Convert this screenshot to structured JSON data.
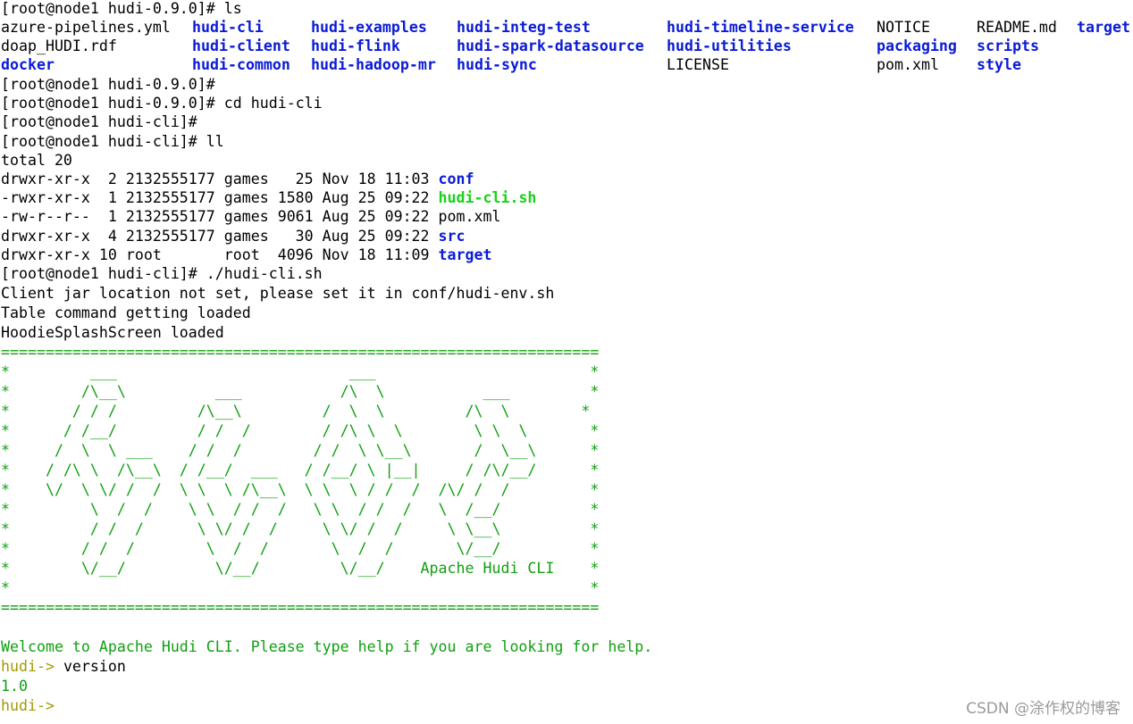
{
  "terminal": {
    "prompt_node": "[root@node1 hudi-0.9.0]#",
    "prompt_cli_dir": "[root@node1 hudi-cli]#",
    "cmd_ls": " ls",
    "cmd_cd": " cd hudi-cli",
    "cmd_ll": " ll",
    "cmd_run": " ./hudi-cli.sh",
    "ls_output": [
      [
        {
          "text": "azure-pipelines.yml",
          "kind": "file"
        },
        {
          "text": "hudi-cli",
          "kind": "dir"
        },
        {
          "text": "hudi-examples",
          "kind": "dir"
        },
        {
          "text": "hudi-integ-test",
          "kind": "dir"
        },
        {
          "text": "hudi-timeline-service",
          "kind": "dir"
        },
        {
          "text": "NOTICE",
          "kind": "file"
        },
        {
          "text": "README.md",
          "kind": "file"
        },
        {
          "text": "target",
          "kind": "dir"
        }
      ],
      [
        {
          "text": "doap_HUDI.rdf",
          "kind": "file"
        },
        {
          "text": "hudi-client",
          "kind": "dir"
        },
        {
          "text": "hudi-flink",
          "kind": "dir"
        },
        {
          "text": "hudi-spark-datasource",
          "kind": "dir"
        },
        {
          "text": "hudi-utilities",
          "kind": "dir"
        },
        {
          "text": "packaging",
          "kind": "dir"
        },
        {
          "text": "scripts",
          "kind": "dir"
        }
      ],
      [
        {
          "text": "docker",
          "kind": "dir"
        },
        {
          "text": "hudi-common",
          "kind": "dir"
        },
        {
          "text": "hudi-hadoop-mr",
          "kind": "dir"
        },
        {
          "text": "hudi-sync",
          "kind": "dir"
        },
        {
          "text": "LICENSE",
          "kind": "file"
        },
        {
          "text": "pom.xml",
          "kind": "file"
        },
        {
          "text": "style",
          "kind": "dir"
        }
      ]
    ],
    "total": "total 20",
    "ll_rows": [
      {
        "meta": "drwxr-xr-x  2 2132555177 games   25 Nov 18 11:03 ",
        "name": "conf",
        "kind": "dir"
      },
      {
        "meta": "-rwxr-xr-x  1 2132555177 games 1580 Aug 25 09:22 ",
        "name": "hudi-cli.sh",
        "kind": "exe"
      },
      {
        "meta": "-rw-r--r--  1 2132555177 games 9061 Aug 25 09:22 ",
        "name": "pom.xml",
        "kind": "file"
      },
      {
        "meta": "drwxr-xr-x  4 2132555177 games   30 Aug 25 09:22 ",
        "name": "src",
        "kind": "dir"
      },
      {
        "meta": "drwxr-xr-x 10 root       root  4096 Nov 18 11:09 ",
        "name": "target",
        "kind": "dir"
      }
    ],
    "messages": [
      "Client jar location not set, please set it in conf/hudi-env.sh",
      "Table command getting loaded",
      "HoodieSplashScreen loaded"
    ],
    "banner_lines": [
      "===================================================================",
      "*         ___                          ___                        *",
      "*        /\\__\\          ___           /\\  \\           ___         *",
      "*       / / /         /\\__\\         /  \\  \\         /\\  \\        *",
      "*      / /__/         / /  /        / /\\ \\  \\        \\ \\  \\       *",
      "*     /  \\  \\ ___    / /  /        / /  \\ \\__\\       /  \\__\\      *",
      "*    / /\\ \\  /\\__\\  / /__/  ___   / /__/ \\ |__|     / /\\/__/      *",
      "*    \\/  \\ \\/ /  /  \\ \\  \\ /\\__\\  \\ \\  \\ / /  /  /\\/ /  /         *",
      "*         \\  /  /    \\ \\  / /  /   \\ \\  / /  /   \\  /__/          *",
      "*         / /  /      \\ \\/ /  /     \\ \\/ /  /     \\ \\__\\          *",
      "*        / /  /        \\  /  /       \\  /  /       \\/__/          *",
      "*        \\/__/          \\/__/         \\/__/    Apache Hudi CLI    *",
      "*                                                                 *",
      "==================================================================="
    ],
    "welcome": "Welcome to Apache Hudi CLI. Please type help if you are looking for help.",
    "hudi_prompt": "hudi->",
    "version_cmd": " version",
    "version_output": "1.0"
  },
  "colors": {
    "directory": "#0b1bd6",
    "executable": "#19d219",
    "banner": "#11a011",
    "hudi_prompt": "#a39a00"
  },
  "watermark": "CSDN @涂作权的博客"
}
